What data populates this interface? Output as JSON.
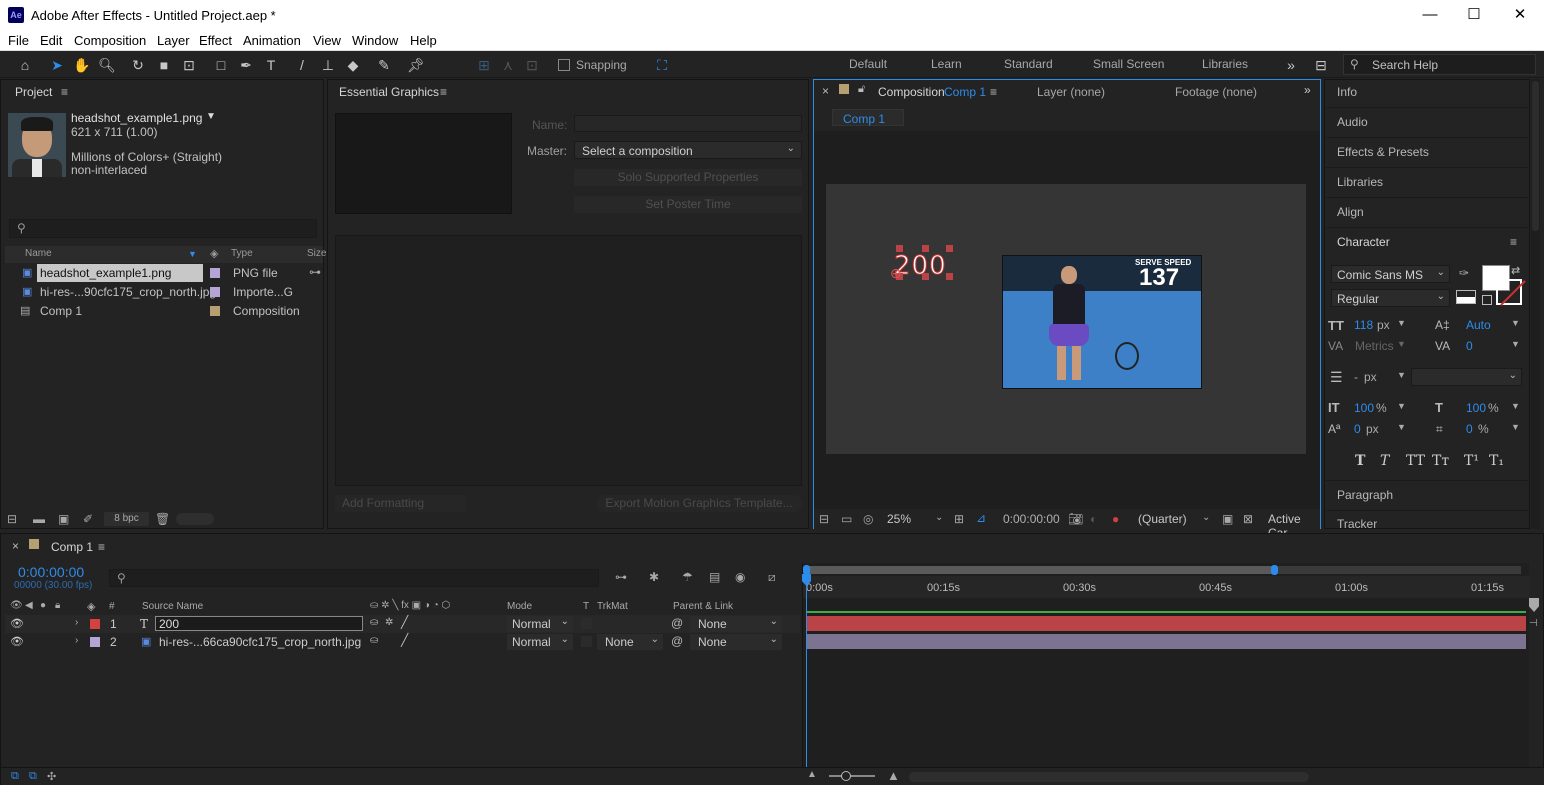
{
  "app": {
    "title": "Adobe After Effects - Untitled Project.aep *",
    "logo": "Ae",
    "window_buttons": [
      "—",
      "☐",
      "✕"
    ]
  },
  "menu": [
    "File",
    "Edit",
    "Composition",
    "Layer",
    "Effect",
    "Animation",
    "View",
    "Window",
    "Help"
  ],
  "toolbar": {
    "snapping_label": "Snapping",
    "workspaces": [
      "Default",
      "Learn",
      "Standard",
      "Small Screen",
      "Libraries"
    ],
    "search_placeholder": "Search Help"
  },
  "project": {
    "tab": "Project",
    "preview": {
      "name": "headshot_example1.png",
      "dims": "621 x 711 (1.00)",
      "colors": "Millions of Colors+ (Straight)",
      "interlace": "non-interlaced"
    },
    "columns": {
      "name": "Name",
      "type": "Type",
      "size": "Size"
    },
    "items": [
      {
        "name": "headshot_example1.png",
        "type": "PNG file",
        "color": "#b4a5d6",
        "selected": true
      },
      {
        "name": "hi-res-...90cfc175_crop_north.jpg",
        "type": "Importe...G",
        "color": "#b4a5d6"
      },
      {
        "name": "Comp 1",
        "type": "Composition",
        "color": "#b6a072"
      }
    ],
    "bpc": "8 bpc"
  },
  "essential_graphics": {
    "tab": "Essential Graphics",
    "name_label": "Name:",
    "master_label": "Master:",
    "master_value": "Select a composition",
    "solo_btn": "Solo Supported Properties",
    "poster_btn": "Set Poster Time",
    "add_formatting": "Add Formatting",
    "export_btn": "Export Motion Graphics Template..."
  },
  "viewer": {
    "tab_prefix": "Composition",
    "tab_comp": "Comp 1",
    "layer_tab": "Layer (none)",
    "footage_tab": "Footage (none)",
    "crumb": "Comp 1",
    "text_layer": "200",
    "zoom": "25%",
    "timecode": "0:00:00:00",
    "resolution": "(Quarter)",
    "camera": "Active Car",
    "photo_caption_top": "SERVE SPEED",
    "photo_caption_num": "137"
  },
  "right_panels": {
    "items": [
      "Info",
      "Audio",
      "Effects & Presets",
      "Libraries",
      "Align"
    ],
    "character": {
      "title": "Character",
      "font": "Comic Sans MS",
      "style": "Regular",
      "size": "118",
      "size_unit": "px",
      "leading": "Auto",
      "kerning": "Metrics",
      "tracking": "0",
      "stroke": "-",
      "stroke_unit": "px",
      "vscale": "100",
      "hscale": "100",
      "pct": "%",
      "baseline": "0",
      "baseline_unit": "px",
      "tsume": "0",
      "tsume_unit": "%",
      "styles": [
        "T",
        "T",
        "TT",
        "Tт",
        "T¹",
        "T₁"
      ]
    },
    "paragraph": "Paragraph",
    "tracker": "Tracker"
  },
  "timeline": {
    "tab": "Comp 1",
    "timecode": "0:00:00:00",
    "frames": "00000 (30.00 fps)",
    "headers": {
      "source": "Source Name",
      "mode": "Mode",
      "t": "T",
      "trkmat": "TrkMat",
      "parent": "Parent & Link"
    },
    "ruler": [
      "0:00s",
      "00:15s",
      "00:30s",
      "00:45s",
      "01:00s",
      "01:15s"
    ],
    "layers": [
      {
        "num": "1",
        "type": "T",
        "name": "200",
        "mode": "Normal",
        "trkmat": "",
        "parent": "None",
        "color": "#d4413f",
        "bar": "#b94346"
      },
      {
        "num": "2",
        "type": "img",
        "name": "hi-res-...66ca90cfc175_crop_north.jpg",
        "mode": "Normal",
        "trkmat": "None",
        "parent": "None",
        "color": "#b4a5d6",
        "bar": "#7b7390"
      }
    ]
  },
  "colors": {
    "accent": "#2d8ceb",
    "panel": "#232323",
    "titlebar": "#ffffff"
  }
}
